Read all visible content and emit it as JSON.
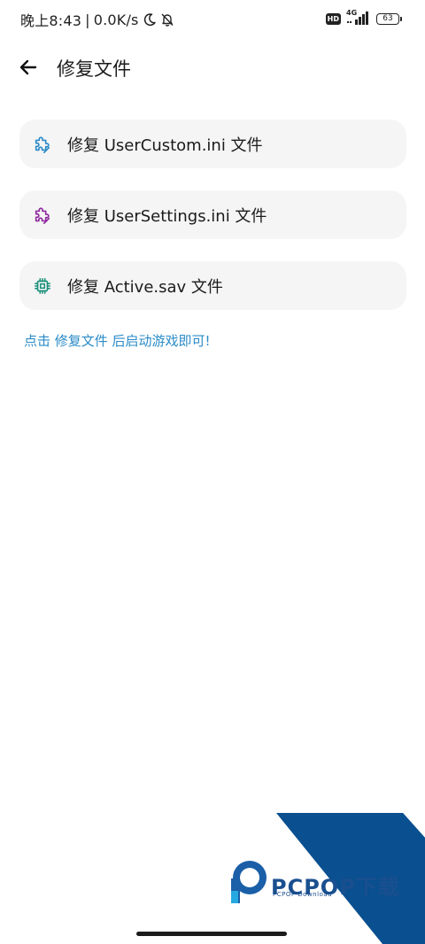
{
  "status_bar": {
    "time": "晚上8:43",
    "separator": "|",
    "net_speed": "0.0K/s",
    "hd_badge": "HD",
    "network": "4G",
    "battery": "63"
  },
  "app_bar": {
    "title": "修复文件"
  },
  "fix_items": [
    {
      "label": "修复 UserCustom.ini 文件",
      "icon": "puzzle-icon",
      "color": "#2b8bc8"
    },
    {
      "label": "修复 UserSettings.ini 文件",
      "icon": "puzzle-icon",
      "color": "#8e2a9e"
    },
    {
      "label": "修复 Active.sav 文件",
      "icon": "chip-icon",
      "color": "#1a8f7a"
    }
  ],
  "hint": "点击 修复文件 后启动游戏即可!",
  "watermark": {
    "text": "PCPOP下载",
    "subtext": "PCPOP Download"
  },
  "colors": {
    "accent": "#2b8bc8",
    "card_bg": "#f5f5f5",
    "watermark_blue": "#0a4f8f"
  }
}
